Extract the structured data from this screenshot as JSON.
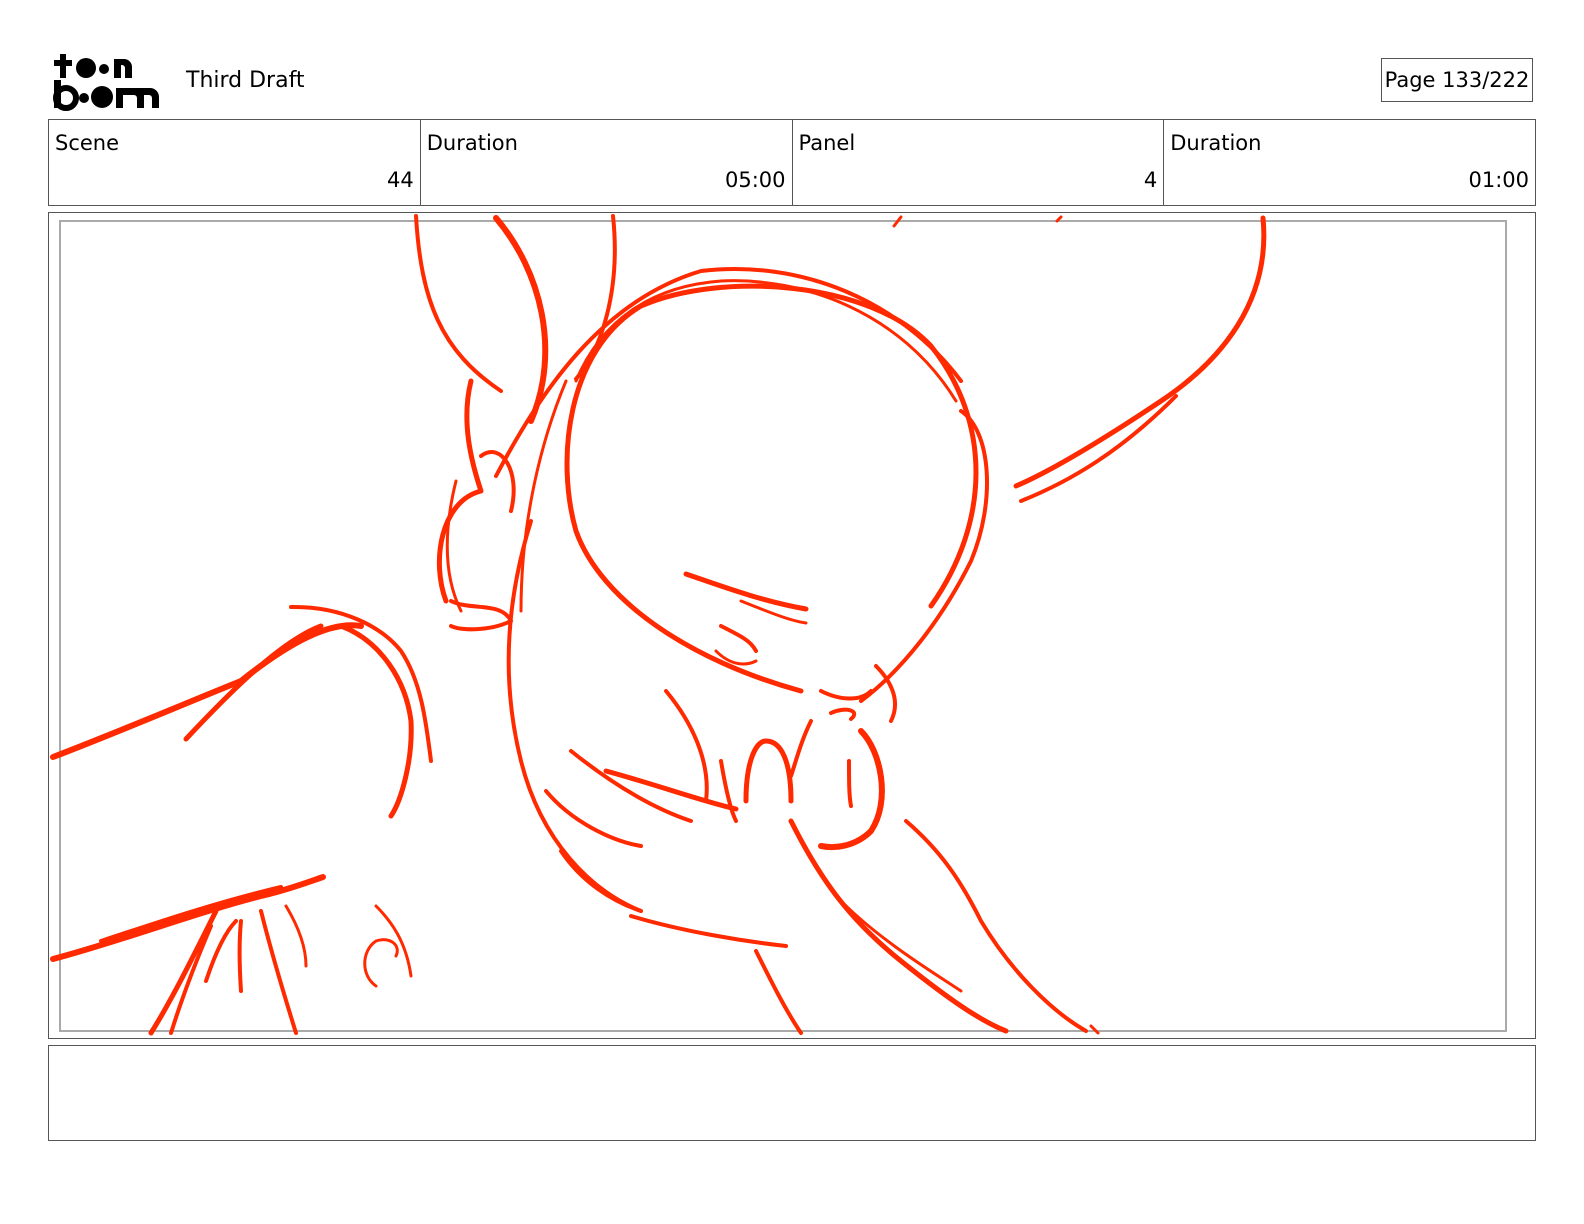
{
  "header": {
    "logo_text_top": "toon",
    "logo_text_bottom": "boom",
    "draft_title": "Third Draft",
    "page_label": "Page 133/222"
  },
  "info": {
    "scene_label": "Scene",
    "scene_value": "44",
    "scene_duration_label": "Duration",
    "scene_duration_value": "05:00",
    "panel_label": "Panel",
    "panel_value": "4",
    "panel_duration_label": "Duration",
    "panel_duration_value": "01:00"
  },
  "notes": {
    "text": ""
  },
  "colors": {
    "sketch_stroke": "#ff2a00",
    "border": "#555555"
  }
}
